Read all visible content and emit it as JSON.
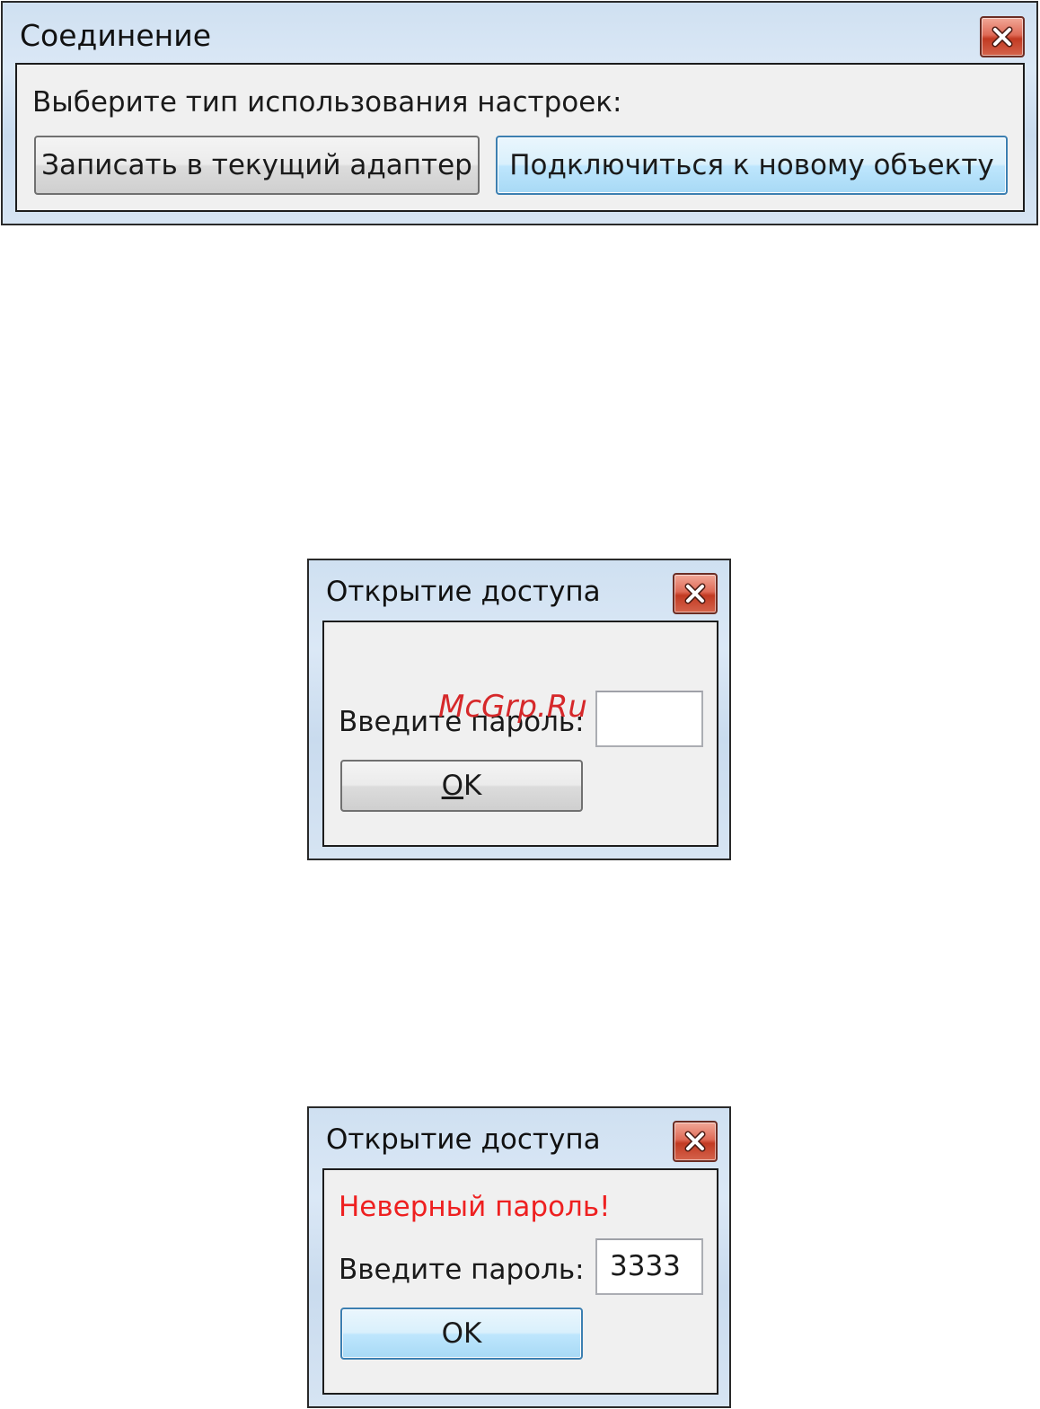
{
  "dialog_connection": {
    "title": "Соединение",
    "prompt": "Выберите тип использования настроек:",
    "button_write": "Записать в текущий адаптер",
    "button_connect": "Подключиться к новому объекту"
  },
  "dialog_access": {
    "title": "Открытие доступа",
    "password_label": "Введите пароль:",
    "password_value": "",
    "ok_mnemonic": "O",
    "ok_rest": "K"
  },
  "watermark": "McGrp.Ru",
  "dialog_access_error": {
    "title": "Открытие доступа",
    "error_text": "Неверный пароль!",
    "password_label": "Введите пароль:",
    "password_value": "3333",
    "ok_label": "OK"
  },
  "icons": {
    "close": "close-icon"
  },
  "colors": {
    "error": "#ee2020",
    "focus_border": "#3c7fb1",
    "close_button": "#c23a22"
  }
}
